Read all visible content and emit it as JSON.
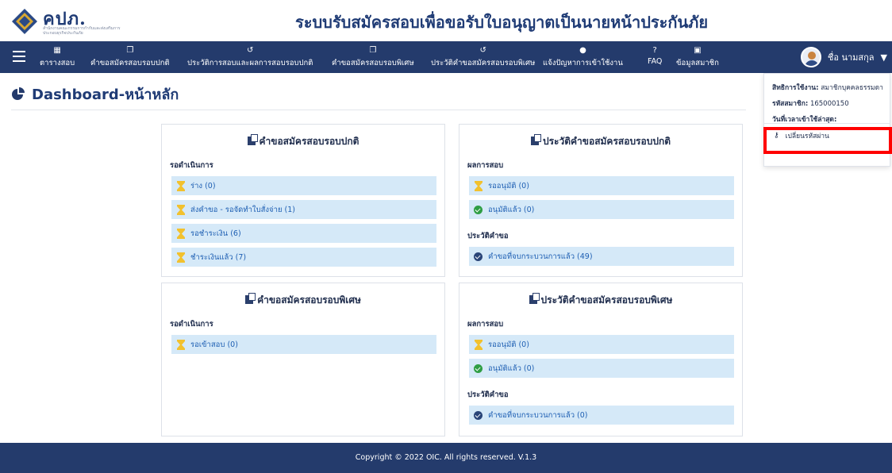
{
  "header": {
    "logo_text": "คปภ.",
    "logo_sub": "สำนักงานคณะกรรมการกำกับและส่งเสริมการประกอบธุรกิจประกันภัย",
    "site_title": "ระบบรับสมัครสอบเพื่อขอรับใบอนุญาตเป็นนายหน้าประกันภัย"
  },
  "navbar": {
    "items": [
      {
        "label": "ตารางสอบ",
        "icon": "calendar-icon",
        "glyph": "▦"
      },
      {
        "label": "คำขอสมัครสอบรอบปกติ",
        "icon": "copy-icon",
        "glyph": "❐"
      },
      {
        "label": "ประวัติการสอบและผลการสอบรอบปกติ",
        "icon": "history-icon",
        "glyph": "↺"
      },
      {
        "label": "คำขอสมัครสอบรอบพิเศษ",
        "icon": "copy-icon",
        "glyph": "❐"
      },
      {
        "label": "ประวัติคำขอสมัครสอบรอบพิเศษ",
        "icon": "history-icon",
        "glyph": "↺"
      },
      {
        "label": "แจ้งปัญหาการเข้าใช้งาน",
        "icon": "comment-icon",
        "glyph": "●"
      },
      {
        "label": "FAQ",
        "icon": "question-icon",
        "glyph": "?"
      },
      {
        "label": "ข้อมูลสมาชิก",
        "icon": "id-card-icon",
        "glyph": "▣"
      }
    ],
    "user_name": "ชื่อ นามสกุล"
  },
  "page": {
    "title": "Dashboard-หน้าหลัก"
  },
  "cards": {
    "normal_request": {
      "title": "คำขอสมัครสอบรอบปกติ",
      "section": "รอดำเนินการ",
      "rows": [
        "ร่าง (0)",
        "ส่งคำขอ - รอจัดทำใบสั่งจ่าย (1)",
        "รอชำระเงิน (6)",
        "ชำระเงินแล้ว (7)"
      ]
    },
    "normal_history": {
      "title": "ประวัติคำขอสมัครสอบรอบปกติ",
      "section_result": "ผลการสอบ",
      "result_rows": [
        "รออนุมัติ (0)",
        "อนุมัติแล้ว (0)"
      ],
      "section_history": "ประวัติคำขอ",
      "history_rows": [
        "คำขอที่จบกระบวนการแล้ว (49)"
      ]
    },
    "special_request": {
      "title": "คำขอสมัครสอบรอบพิเศษ",
      "section": "รอดำเนินการ",
      "rows": [
        "รอเข้าสอบ (0)"
      ]
    },
    "special_history": {
      "title": "ประวัติคำขอสมัครสอบรอบพิเศษ",
      "section_result": "ผลการสอบ",
      "result_rows": [
        "รออนุมัติ (0)",
        "อนุมัติแล้ว (0)"
      ],
      "section_history": "ประวัติคำขอ",
      "history_rows": [
        "คำขอที่จบกระบวนการแล้ว (0)"
      ]
    }
  },
  "user_menu": {
    "role_label": "สิทธิการใช้งาน:",
    "role_value": "สมาชิกบุคคลธรรมดา",
    "member_label": "รหัสสมาชิก:",
    "member_value": "165000150",
    "last_login_label": "วันที่เวลาเข้าใช้ล่าสุด:",
    "change_password": "เปลี่ยนรหัสผ่าน"
  },
  "footer": {
    "copyright": "Copyright © 2022 OIC. All rights reserved. V.1.3"
  },
  "colors": {
    "navbar": "#243b6c",
    "row_bg": "#d5e9f8",
    "row_text": "#1e5fb3",
    "pending_icon": "#f2c12e",
    "approved_icon": "#2f9e44",
    "highlight": "#ff0000"
  }
}
